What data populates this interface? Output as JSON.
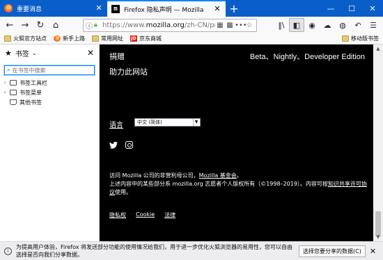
{
  "tabs": [
    {
      "title": "重要消息",
      "active": false,
      "icon": "firefox-icon"
    },
    {
      "title": "Firefox 隐私声明 — Mozilla",
      "active": true,
      "icon": "mozilla-m-icon"
    }
  ],
  "new_tab_symbol": "+",
  "window_controls": {
    "minimize": "—",
    "maximize": "☐",
    "close": "✕"
  },
  "navbar": {
    "back": "←",
    "forward": "→",
    "reload": "↻",
    "home": "⌂",
    "url_host": "https://www.",
    "url_domain": "mozilla.org",
    "url_path": "/zh-CN/pr",
    "page_actions": "•••",
    "bookmark_star": "☆"
  },
  "bookmarks_bar": {
    "items": [
      "火狐官方站点",
      "新手上路",
      "常用网址",
      "京东商城"
    ],
    "mobile": "移动版书签"
  },
  "sidebar": {
    "title": "书签",
    "search_placeholder": "在书签中搜索",
    "tree": [
      "书签工具栏",
      "书签菜单",
      "其他书签"
    ]
  },
  "content": {
    "donate": "捐赠",
    "editions": "Beta、Nightly、Developer Edition",
    "help": "助力此网站",
    "language_label": "语言",
    "language_value": "中文 (简体)",
    "legal_line1": "访问 Mozilla 公司的非营利母公司，",
    "legal_line1_link": "Mozilla 基金会",
    "legal_line1_end": "。",
    "legal_line2_a": "上述内容中的某些部分系 mozilla.org 志愿者个人版权所有（©1998–2019）。内容可按",
    "legal_line2_link": "知识共享许可协议",
    "legal_line2_b": "使用。",
    "footer_links": [
      "隐私权",
      "Cookie",
      "法律"
    ]
  },
  "notification": {
    "text": "为提高用户体验，Firefox 将发送部分功能的使用情况给我们，用于进一步优化火狐浏览器的易用性，您可以自由选择是否向我们分享数据。",
    "button": "选择您要分享的数据(C)",
    "close": "✕"
  },
  "colors": {
    "tabstrip": "#0a5ec9",
    "accent": "#0a84ff",
    "content_bg": "#000000"
  }
}
